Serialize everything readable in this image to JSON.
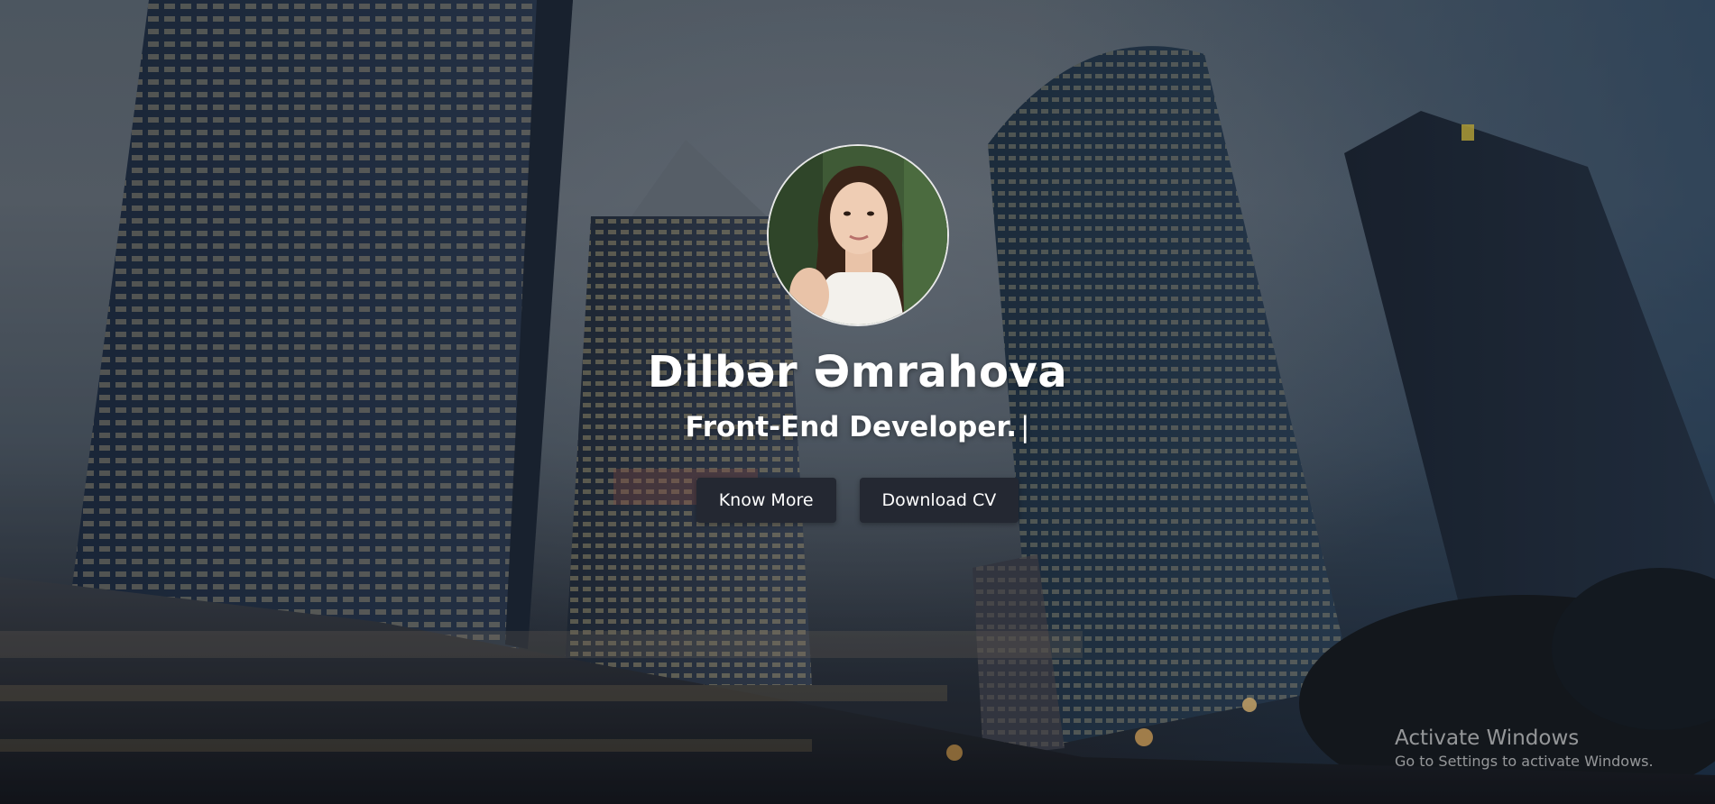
{
  "hero": {
    "name": "Dilbər Əmrahova",
    "role": "Front-End Developer.",
    "cursor": "|",
    "buttons": {
      "know_more": "Know More",
      "download_cv": "Download CV"
    },
    "background": "night-city-skyscrapers-photo",
    "avatar": "profile-photo"
  },
  "os_watermark": {
    "title": "Activate Windows",
    "subtitle": "Go to Settings to activate Windows."
  },
  "colors": {
    "button_bg": "#242832",
    "text": "#ffffff"
  }
}
